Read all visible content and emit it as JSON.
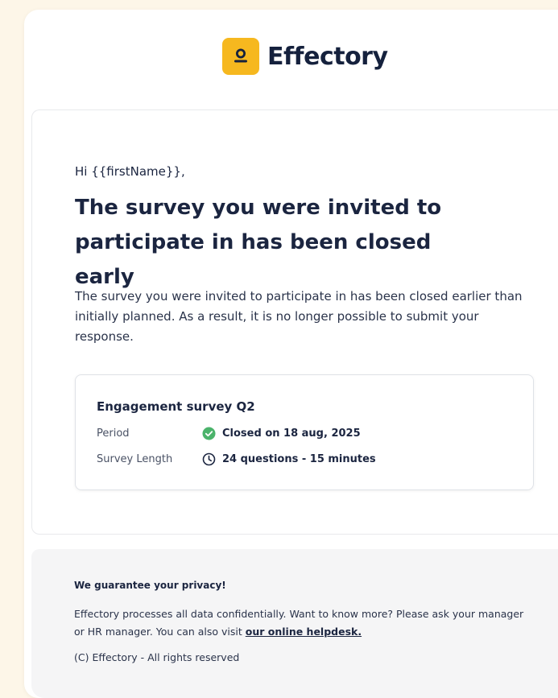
{
  "brand": {
    "name": "Effectory",
    "logo_color": "#f6b81f"
  },
  "email": {
    "greeting": "Hi {{firstName}},",
    "headline": "The survey you were invited to participate in has been closed early",
    "body": "The survey you were invited to participate in has been closed earlier than initially planned. As a result, it is no longer possible to submit your response."
  },
  "survey": {
    "title": "Engagement survey Q2",
    "period_label": "Period",
    "period_value": "Closed on 18 aug, 2025",
    "period_icon": "check-circle-icon",
    "length_label": "Survey Length",
    "length_value": "24 questions - 15 minutes",
    "length_icon": "clock-icon"
  },
  "footer": {
    "title": "We guarantee your privacy!",
    "text": "Effectory processes all data confidentially. Want to know more? Please ask your manager or HR manager. You can also visit",
    "link_text": "our online helpdesk.",
    "copyright": "(C) Effectory - All rights reserved"
  },
  "colors": {
    "background": "#fdf6e8",
    "text": "#1b2540",
    "success": "#4bb36b"
  }
}
